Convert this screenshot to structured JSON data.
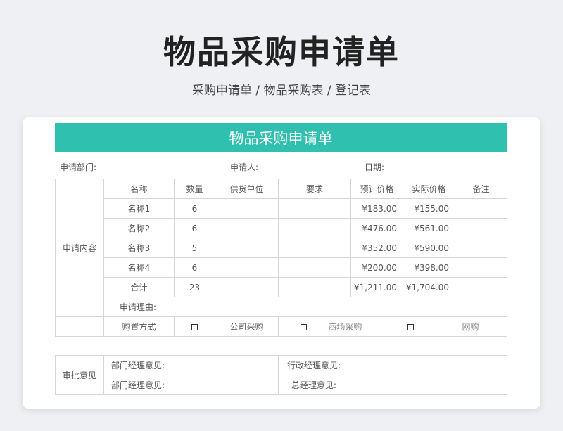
{
  "header": {
    "title": "物品采购申请单",
    "subtitle": "采购申请单 / 物品采购表 / 登记表"
  },
  "form": {
    "banner_title": "物品采购申请单",
    "department_label": "申请部门:",
    "applicant_label": "申请人:",
    "date_label": "日期:",
    "section_label": "申请内容",
    "columns": [
      "名称",
      "数量",
      "供货单位",
      "要求",
      "预计价格",
      "实际价格",
      "备注"
    ],
    "rows": [
      {
        "name": "名称1",
        "qty": "6",
        "supplier": "",
        "req": "",
        "est": "¥183.00",
        "actual": "¥155.00",
        "note": ""
      },
      {
        "name": "名称2",
        "qty": "6",
        "supplier": "",
        "req": "",
        "est": "¥476.00",
        "actual": "¥561.00",
        "note": ""
      },
      {
        "name": "名称3",
        "qty": "5",
        "supplier": "",
        "req": "",
        "est": "¥352.00",
        "actual": "¥590.00",
        "note": ""
      },
      {
        "name": "名称4",
        "qty": "6",
        "supplier": "",
        "req": "",
        "est": "¥200.00",
        "actual": "¥398.00",
        "note": ""
      }
    ],
    "total": {
      "label": "合计",
      "qty": "23",
      "est": "¥1,211.00",
      "actual": "¥1,704.00"
    },
    "reason_label": "申请理由:",
    "purchase_method_label": "购置方式",
    "purchase_options": [
      "公司采购",
      "商场采购",
      "网购"
    ]
  },
  "approval": {
    "section_label": "审批意见",
    "dept_manager_1": "部门经理意见:",
    "admin_manager": "行政经理意见:",
    "dept_manager_2": "部门经理意见:",
    "general_manager": "总经理意见:"
  }
}
